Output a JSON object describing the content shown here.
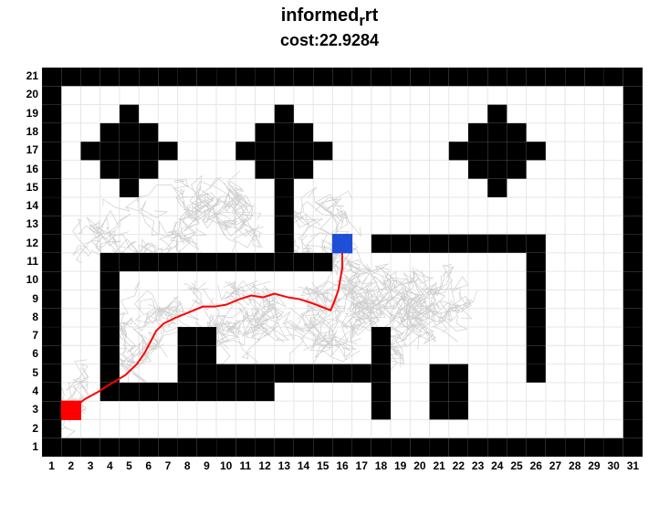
{
  "title_main": "informed",
  "title_sub": "r",
  "title_tail": "rt",
  "subtitle_prefix": "cost:",
  "subtitle_value": "22.9284",
  "chart_data": {
    "type": "heatmap",
    "title": "informed_rrt",
    "subtitle": "cost:22.9284",
    "xlabel": "",
    "ylabel": "",
    "xlim": [
      1,
      31
    ],
    "ylim": [
      1,
      21
    ],
    "xticks": [
      1,
      2,
      3,
      4,
      5,
      6,
      7,
      8,
      9,
      10,
      11,
      12,
      13,
      14,
      15,
      16,
      17,
      18,
      19,
      20,
      21,
      22,
      23,
      24,
      25,
      26,
      27,
      28,
      29,
      30,
      31
    ],
    "yticks": [
      1,
      2,
      3,
      4,
      5,
      6,
      7,
      8,
      9,
      10,
      11,
      12,
      13,
      14,
      15,
      16,
      17,
      18,
      19,
      20,
      21
    ],
    "start": {
      "x": 2.5,
      "y": 3.5
    },
    "goal": {
      "x": 16.5,
      "y": 12.5
    },
    "path_points": [
      [
        2.5,
        3.5
      ],
      [
        3.2,
        4.1
      ],
      [
        3.9,
        4.5
      ],
      [
        4.5,
        4.9
      ],
      [
        5.3,
        5.4
      ],
      [
        5.9,
        6.0
      ],
      [
        6.3,
        6.6
      ],
      [
        6.6,
        7.2
      ],
      [
        6.9,
        7.8
      ],
      [
        7.3,
        8.2
      ],
      [
        7.9,
        8.5
      ],
      [
        8.6,
        8.8
      ],
      [
        9.3,
        9.1
      ],
      [
        9.9,
        9.1
      ],
      [
        10.5,
        9.2
      ],
      [
        11.2,
        9.5
      ],
      [
        11.8,
        9.7
      ],
      [
        12.4,
        9.6
      ],
      [
        13.0,
        9.8
      ],
      [
        13.7,
        9.6
      ],
      [
        14.3,
        9.5
      ],
      [
        14.9,
        9.3
      ],
      [
        15.4,
        9.1
      ],
      [
        15.9,
        8.9
      ],
      [
        16.1,
        9.4
      ],
      [
        16.3,
        10.0
      ],
      [
        16.4,
        10.6
      ],
      [
        16.5,
        11.2
      ],
      [
        16.5,
        11.8
      ],
      [
        16.5,
        12.5
      ]
    ],
    "obstacles": [
      {
        "x": 1,
        "y": 21
      },
      {
        "x": 2,
        "y": 21
      },
      {
        "x": 3,
        "y": 21
      },
      {
        "x": 4,
        "y": 21
      },
      {
        "x": 5,
        "y": 21
      },
      {
        "x": 6,
        "y": 21
      },
      {
        "x": 7,
        "y": 21
      },
      {
        "x": 8,
        "y": 21
      },
      {
        "x": 9,
        "y": 21
      },
      {
        "x": 10,
        "y": 21
      },
      {
        "x": 11,
        "y": 21
      },
      {
        "x": 12,
        "y": 21
      },
      {
        "x": 13,
        "y": 21
      },
      {
        "x": 14,
        "y": 21
      },
      {
        "x": 15,
        "y": 21
      },
      {
        "x": 16,
        "y": 21
      },
      {
        "x": 17,
        "y": 21
      },
      {
        "x": 18,
        "y": 21
      },
      {
        "x": 19,
        "y": 21
      },
      {
        "x": 20,
        "y": 21
      },
      {
        "x": 21,
        "y": 21
      },
      {
        "x": 22,
        "y": 21
      },
      {
        "x": 23,
        "y": 21
      },
      {
        "x": 24,
        "y": 21
      },
      {
        "x": 25,
        "y": 21
      },
      {
        "x": 26,
        "y": 21
      },
      {
        "x": 27,
        "y": 21
      },
      {
        "x": 28,
        "y": 21
      },
      {
        "x": 29,
        "y": 21
      },
      {
        "x": 30,
        "y": 21
      },
      {
        "x": 31,
        "y": 21
      },
      {
        "x": 1,
        "y": 1
      },
      {
        "x": 2,
        "y": 1
      },
      {
        "x": 3,
        "y": 1
      },
      {
        "x": 4,
        "y": 1
      },
      {
        "x": 5,
        "y": 1
      },
      {
        "x": 6,
        "y": 1
      },
      {
        "x": 7,
        "y": 1
      },
      {
        "x": 8,
        "y": 1
      },
      {
        "x": 9,
        "y": 1
      },
      {
        "x": 10,
        "y": 1
      },
      {
        "x": 11,
        "y": 1
      },
      {
        "x": 12,
        "y": 1
      },
      {
        "x": 13,
        "y": 1
      },
      {
        "x": 14,
        "y": 1
      },
      {
        "x": 15,
        "y": 1
      },
      {
        "x": 16,
        "y": 1
      },
      {
        "x": 17,
        "y": 1
      },
      {
        "x": 18,
        "y": 1
      },
      {
        "x": 19,
        "y": 1
      },
      {
        "x": 20,
        "y": 1
      },
      {
        "x": 21,
        "y": 1
      },
      {
        "x": 22,
        "y": 1
      },
      {
        "x": 23,
        "y": 1
      },
      {
        "x": 24,
        "y": 1
      },
      {
        "x": 25,
        "y": 1
      },
      {
        "x": 26,
        "y": 1
      },
      {
        "x": 27,
        "y": 1
      },
      {
        "x": 28,
        "y": 1
      },
      {
        "x": 29,
        "y": 1
      },
      {
        "x": 30,
        "y": 1
      },
      {
        "x": 31,
        "y": 1
      },
      {
        "x": 1,
        "y": 2
      },
      {
        "x": 1,
        "y": 3
      },
      {
        "x": 1,
        "y": 4
      },
      {
        "x": 1,
        "y": 5
      },
      {
        "x": 1,
        "y": 6
      },
      {
        "x": 1,
        "y": 7
      },
      {
        "x": 1,
        "y": 8
      },
      {
        "x": 1,
        "y": 9
      },
      {
        "x": 1,
        "y": 10
      },
      {
        "x": 1,
        "y": 11
      },
      {
        "x": 1,
        "y": 12
      },
      {
        "x": 1,
        "y": 13
      },
      {
        "x": 1,
        "y": 14
      },
      {
        "x": 1,
        "y": 15
      },
      {
        "x": 1,
        "y": 16
      },
      {
        "x": 1,
        "y": 17
      },
      {
        "x": 1,
        "y": 18
      },
      {
        "x": 1,
        "y": 19
      },
      {
        "x": 1,
        "y": 20
      },
      {
        "x": 31,
        "y": 2
      },
      {
        "x": 31,
        "y": 3
      },
      {
        "x": 31,
        "y": 4
      },
      {
        "x": 31,
        "y": 5
      },
      {
        "x": 31,
        "y": 6
      },
      {
        "x": 31,
        "y": 7
      },
      {
        "x": 31,
        "y": 8
      },
      {
        "x": 31,
        "y": 9
      },
      {
        "x": 31,
        "y": 10
      },
      {
        "x": 31,
        "y": 11
      },
      {
        "x": 31,
        "y": 12
      },
      {
        "x": 31,
        "y": 13
      },
      {
        "x": 31,
        "y": 14
      },
      {
        "x": 31,
        "y": 15
      },
      {
        "x": 31,
        "y": 16
      },
      {
        "x": 31,
        "y": 17
      },
      {
        "x": 31,
        "y": 18
      },
      {
        "x": 31,
        "y": 19
      },
      {
        "x": 31,
        "y": 20
      },
      {
        "x": 5,
        "y": 19
      },
      {
        "x": 4,
        "y": 18
      },
      {
        "x": 5,
        "y": 18
      },
      {
        "x": 6,
        "y": 18
      },
      {
        "x": 3,
        "y": 17
      },
      {
        "x": 4,
        "y": 17
      },
      {
        "x": 5,
        "y": 17
      },
      {
        "x": 6,
        "y": 17
      },
      {
        "x": 7,
        "y": 17
      },
      {
        "x": 4,
        "y": 16
      },
      {
        "x": 5,
        "y": 16
      },
      {
        "x": 6,
        "y": 16
      },
      {
        "x": 5,
        "y": 15
      },
      {
        "x": 13,
        "y": 19
      },
      {
        "x": 12,
        "y": 18
      },
      {
        "x": 13,
        "y": 18
      },
      {
        "x": 14,
        "y": 18
      },
      {
        "x": 11,
        "y": 17
      },
      {
        "x": 12,
        "y": 17
      },
      {
        "x": 13,
        "y": 17
      },
      {
        "x": 14,
        "y": 17
      },
      {
        "x": 15,
        "y": 17
      },
      {
        "x": 12,
        "y": 16
      },
      {
        "x": 13,
        "y": 16
      },
      {
        "x": 14,
        "y": 16
      },
      {
        "x": 13,
        "y": 15
      },
      {
        "x": 13,
        "y": 14
      },
      {
        "x": 13,
        "y": 13
      },
      {
        "x": 13,
        "y": 12
      },
      {
        "x": 24,
        "y": 19
      },
      {
        "x": 23,
        "y": 18
      },
      {
        "x": 24,
        "y": 18
      },
      {
        "x": 25,
        "y": 18
      },
      {
        "x": 22,
        "y": 17
      },
      {
        "x": 23,
        "y": 17
      },
      {
        "x": 24,
        "y": 17
      },
      {
        "x": 25,
        "y": 17
      },
      {
        "x": 26,
        "y": 17
      },
      {
        "x": 23,
        "y": 16
      },
      {
        "x": 24,
        "y": 16
      },
      {
        "x": 25,
        "y": 16
      },
      {
        "x": 24,
        "y": 15
      },
      {
        "x": 18,
        "y": 12
      },
      {
        "x": 19,
        "y": 12
      },
      {
        "x": 20,
        "y": 12
      },
      {
        "x": 21,
        "y": 12
      },
      {
        "x": 22,
        "y": 12
      },
      {
        "x": 23,
        "y": 12
      },
      {
        "x": 24,
        "y": 12
      },
      {
        "x": 25,
        "y": 12
      },
      {
        "x": 26,
        "y": 12
      },
      {
        "x": 4,
        "y": 11
      },
      {
        "x": 5,
        "y": 11
      },
      {
        "x": 6,
        "y": 11
      },
      {
        "x": 7,
        "y": 11
      },
      {
        "x": 8,
        "y": 11
      },
      {
        "x": 9,
        "y": 11
      },
      {
        "x": 10,
        "y": 11
      },
      {
        "x": 11,
        "y": 11
      },
      {
        "x": 12,
        "y": 11
      },
      {
        "x": 13,
        "y": 11
      },
      {
        "x": 14,
        "y": 11
      },
      {
        "x": 15,
        "y": 11
      },
      {
        "x": 4,
        "y": 10
      },
      {
        "x": 4,
        "y": 9
      },
      {
        "x": 4,
        "y": 8
      },
      {
        "x": 4,
        "y": 7
      },
      {
        "x": 4,
        "y": 6
      },
      {
        "x": 4,
        "y": 5
      },
      {
        "x": 26,
        "y": 11
      },
      {
        "x": 26,
        "y": 10
      },
      {
        "x": 26,
        "y": 9
      },
      {
        "x": 26,
        "y": 8
      },
      {
        "x": 26,
        "y": 7
      },
      {
        "x": 26,
        "y": 6
      },
      {
        "x": 26,
        "y": 5
      },
      {
        "x": 8,
        "y": 7
      },
      {
        "x": 9,
        "y": 7
      },
      {
        "x": 8,
        "y": 6
      },
      {
        "x": 9,
        "y": 6
      },
      {
        "x": 8,
        "y": 5
      },
      {
        "x": 9,
        "y": 5
      },
      {
        "x": 10,
        "y": 5
      },
      {
        "x": 11,
        "y": 5
      },
      {
        "x": 12,
        "y": 5
      },
      {
        "x": 13,
        "y": 5
      },
      {
        "x": 14,
        "y": 5
      },
      {
        "x": 15,
        "y": 5
      },
      {
        "x": 16,
        "y": 5
      },
      {
        "x": 17,
        "y": 5
      },
      {
        "x": 18,
        "y": 5
      },
      {
        "x": 18,
        "y": 6
      },
      {
        "x": 18,
        "y": 7
      },
      {
        "x": 18,
        "y": 4
      },
      {
        "x": 18,
        "y": 3
      },
      {
        "x": 21,
        "y": 5
      },
      {
        "x": 22,
        "y": 5
      },
      {
        "x": 21,
        "y": 4
      },
      {
        "x": 22,
        "y": 4
      },
      {
        "x": 21,
        "y": 3
      },
      {
        "x": 22,
        "y": 3
      },
      {
        "x": 4,
        "y": 4
      },
      {
        "x": 5,
        "y": 4
      },
      {
        "x": 6,
        "y": 4
      },
      {
        "x": 7,
        "y": 4
      },
      {
        "x": 8,
        "y": 4
      },
      {
        "x": 9,
        "y": 4
      },
      {
        "x": 10,
        "y": 4
      },
      {
        "x": 11,
        "y": 4
      },
      {
        "x": 12,
        "y": 4
      }
    ]
  }
}
